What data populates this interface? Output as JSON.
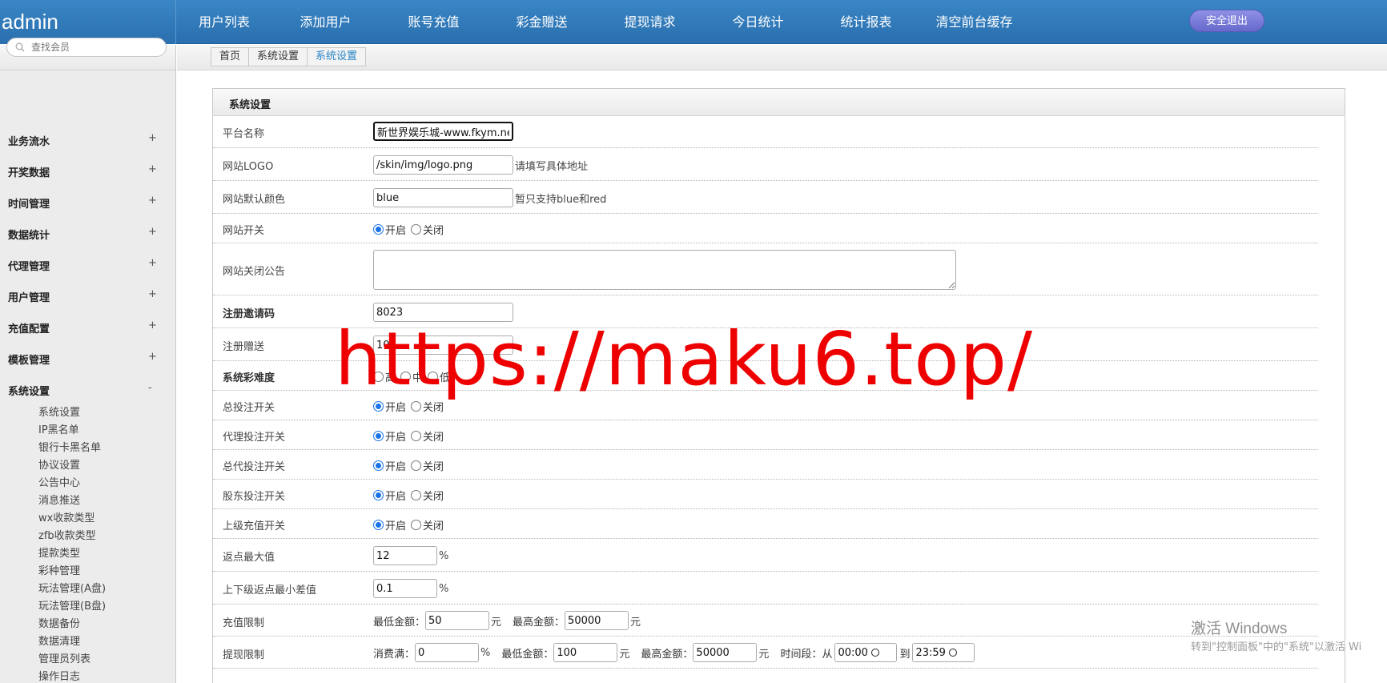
{
  "header": {
    "brand": "admin",
    "nav": [
      "用户列表",
      "添加用户",
      "账号充值",
      "彩金赠送",
      "提现请求",
      "今日统计",
      "统计报表",
      "清空前台缓存"
    ],
    "logout": "安全退出"
  },
  "sidebar": {
    "search_placeholder": "查找会员",
    "groups": [
      {
        "label": "业务流水",
        "toggle": "+"
      },
      {
        "label": "开奖数据",
        "toggle": "+"
      },
      {
        "label": "时间管理",
        "toggle": "+"
      },
      {
        "label": "数据统计",
        "toggle": "+"
      },
      {
        "label": "代理管理",
        "toggle": "+"
      },
      {
        "label": "用户管理",
        "toggle": "+"
      },
      {
        "label": "充值配置",
        "toggle": "+"
      },
      {
        "label": "模板管理",
        "toggle": "+"
      },
      {
        "label": "系统设置",
        "toggle": "-"
      }
    ],
    "sub_items": [
      "系统设置",
      "IP黑名单",
      "银行卡黑名单",
      "协议设置",
      "公告中心",
      "消息推送",
      "wx收款类型",
      "zfb收款类型",
      "提款类型",
      "彩种管理",
      "玩法管理(A盘)",
      "玩法管理(B盘)",
      "数据备份",
      "数据清理",
      "管理员列表",
      "操作日志"
    ]
  },
  "breadcrumb": [
    "首页",
    "系统设置",
    "系统设置"
  ],
  "panel": {
    "title": "系统设置",
    "platform_name": {
      "label": "平台名称",
      "value": "新世界娱乐城-www.fkym.net"
    },
    "logo": {
      "label": "网站LOGO",
      "value": "/skin/img/logo.png",
      "hint": "请填写具体地址"
    },
    "color": {
      "label": "网站默认颜色",
      "value": "blue",
      "hint": "暂只支持blue和red"
    },
    "site_switch": {
      "label": "网站开关",
      "on": "开启",
      "off": "关闭"
    },
    "close_notice": {
      "label": "网站关闭公告",
      "value": ""
    },
    "invite_code": {
      "label": "注册邀请码",
      "value": "8023"
    },
    "register_gift": {
      "label": "注册赠送",
      "value": "10"
    },
    "difficulty": {
      "label": "系统彩难度",
      "options": [
        "高",
        "中",
        "低"
      ]
    },
    "bet_total": {
      "label": "总投注开关",
      "on": "开启",
      "off": "关闭"
    },
    "bet_agent": {
      "label": "代理投注开关",
      "on": "开启",
      "off": "关闭"
    },
    "bet_general_agent": {
      "label": "总代投注开关",
      "on": "开启",
      "off": "关闭"
    },
    "bet_shareholder": {
      "label": "股东投注开关",
      "on": "开启",
      "off": "关闭"
    },
    "recharge_parent": {
      "label": "上级充值开关",
      "on": "开启",
      "off": "关闭"
    },
    "rebate_max": {
      "label": "返点最大值",
      "value": "12",
      "unit": "%"
    },
    "rebate_diff": {
      "label": "上下级返点最小差值",
      "value": "0.1",
      "unit": "%"
    },
    "recharge_limit": {
      "label": "充值限制",
      "min_label": "最低金额：",
      "min": "50",
      "yuan1": "元",
      "max_label": "最高金额：",
      "max": "50000",
      "yuan2": "元"
    },
    "withdraw_limit": {
      "label": "提现限制",
      "consume_label": "消费满：",
      "consume": "0",
      "pct": "%",
      "min_label": "最低金额：",
      "min": "100",
      "yuan1": "元",
      "max_label": "最高金额：",
      "max": "50000",
      "yuan2": "元",
      "time_label": "时间段：",
      "from": "从",
      "start": "00:00",
      "to": "到",
      "end": "23:59"
    }
  },
  "overlay": {
    "watermark": "https://maku6.top/",
    "win_title": "激活 Windows",
    "win_sub": "转到\"控制面板\"中的\"系统\"以激活 Wi"
  }
}
